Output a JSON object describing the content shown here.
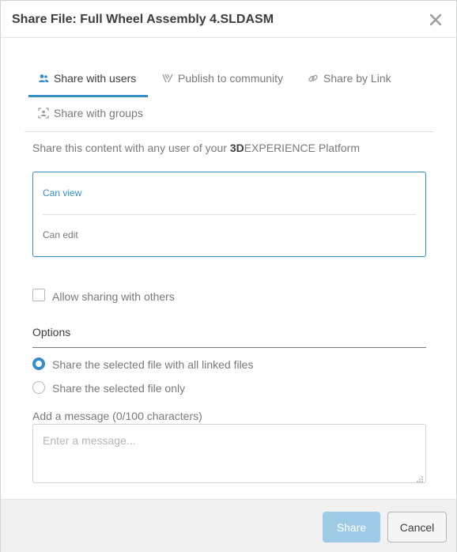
{
  "dialog": {
    "title": "Share File: Full Wheel Assembly 4.SLDASM",
    "close_icon": "close-icon"
  },
  "tabs": [
    {
      "label": "Share with users",
      "icon": "users-icon",
      "active": true
    },
    {
      "label": "Publish to community",
      "icon": "community-icon",
      "active": false
    },
    {
      "label": "Share by Link",
      "icon": "link-icon",
      "active": false
    },
    {
      "label": "Share with groups",
      "icon": "groups-icon",
      "active": false
    }
  ],
  "intro": {
    "prefix": "Share this content with any user of your ",
    "brand_bold": "3D",
    "brand_rest": "EXPERIENCE Platform"
  },
  "permissions": {
    "view_label": "Can view",
    "edit_label": "Can edit",
    "selected": "Can view"
  },
  "allow_sharing": {
    "label": "Allow sharing with others",
    "checked": false
  },
  "options": {
    "title": "Options",
    "items": [
      {
        "label": "Share the selected file with all linked files",
        "checked": true
      },
      {
        "label": "Share the selected file only",
        "checked": false
      }
    ]
  },
  "message": {
    "label": "Add a message (0/100 characters)",
    "placeholder": "Enter a message...",
    "value": ""
  },
  "footer": {
    "share_label": "Share",
    "cancel_label": "Cancel"
  },
  "colors": {
    "accent": "#368ec4",
    "share_button_disabled": "#9fcae5",
    "footer_bg": "#f1f1f1"
  }
}
